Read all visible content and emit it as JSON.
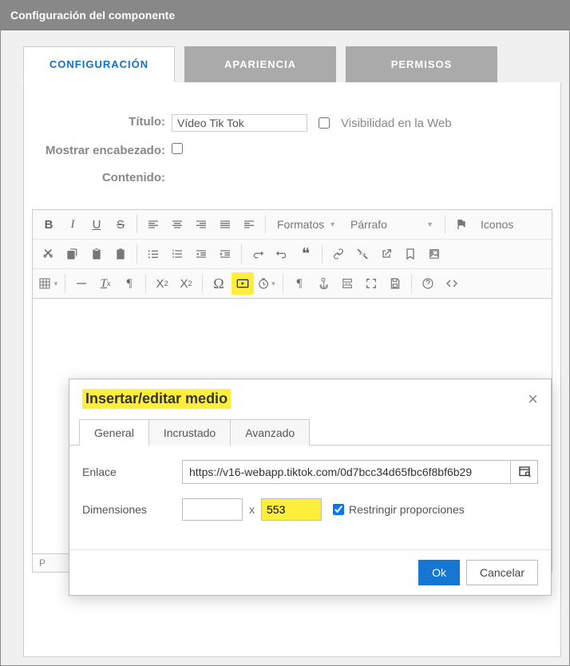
{
  "window": {
    "title": "Configuración del componente"
  },
  "tabs": {
    "config": "CONFIGURACIÓN",
    "appearance": "APARIENCIA",
    "permissions": "PERMISOS"
  },
  "form": {
    "title_label": "Título:",
    "title_value": "Vídeo Tik Tok",
    "visibility_label": "Visibilidad en la Web",
    "show_header_label": "Mostrar encabezado:",
    "content_label": "Contenido:"
  },
  "toolbar": {
    "formats": "Formatos",
    "paragraph": "Párrafo",
    "icons": "Iconos"
  },
  "statusbar": {
    "path": "P"
  },
  "modal": {
    "title": "Insertar/editar medio",
    "tabs": {
      "general": "General",
      "embed": "Incrustado",
      "advanced": "Avanzado"
    },
    "link_label": "Enlace",
    "link_value": "https://v16-webapp.tiktok.com/0d7bcc34d65fbc6f8bf6b29",
    "dimensions_label": "Dimensiones",
    "width_value": "",
    "height_value": "553",
    "dim_sep": "x",
    "constrain_label": "Restringir proporciones",
    "ok": "Ok",
    "cancel": "Cancelar"
  }
}
